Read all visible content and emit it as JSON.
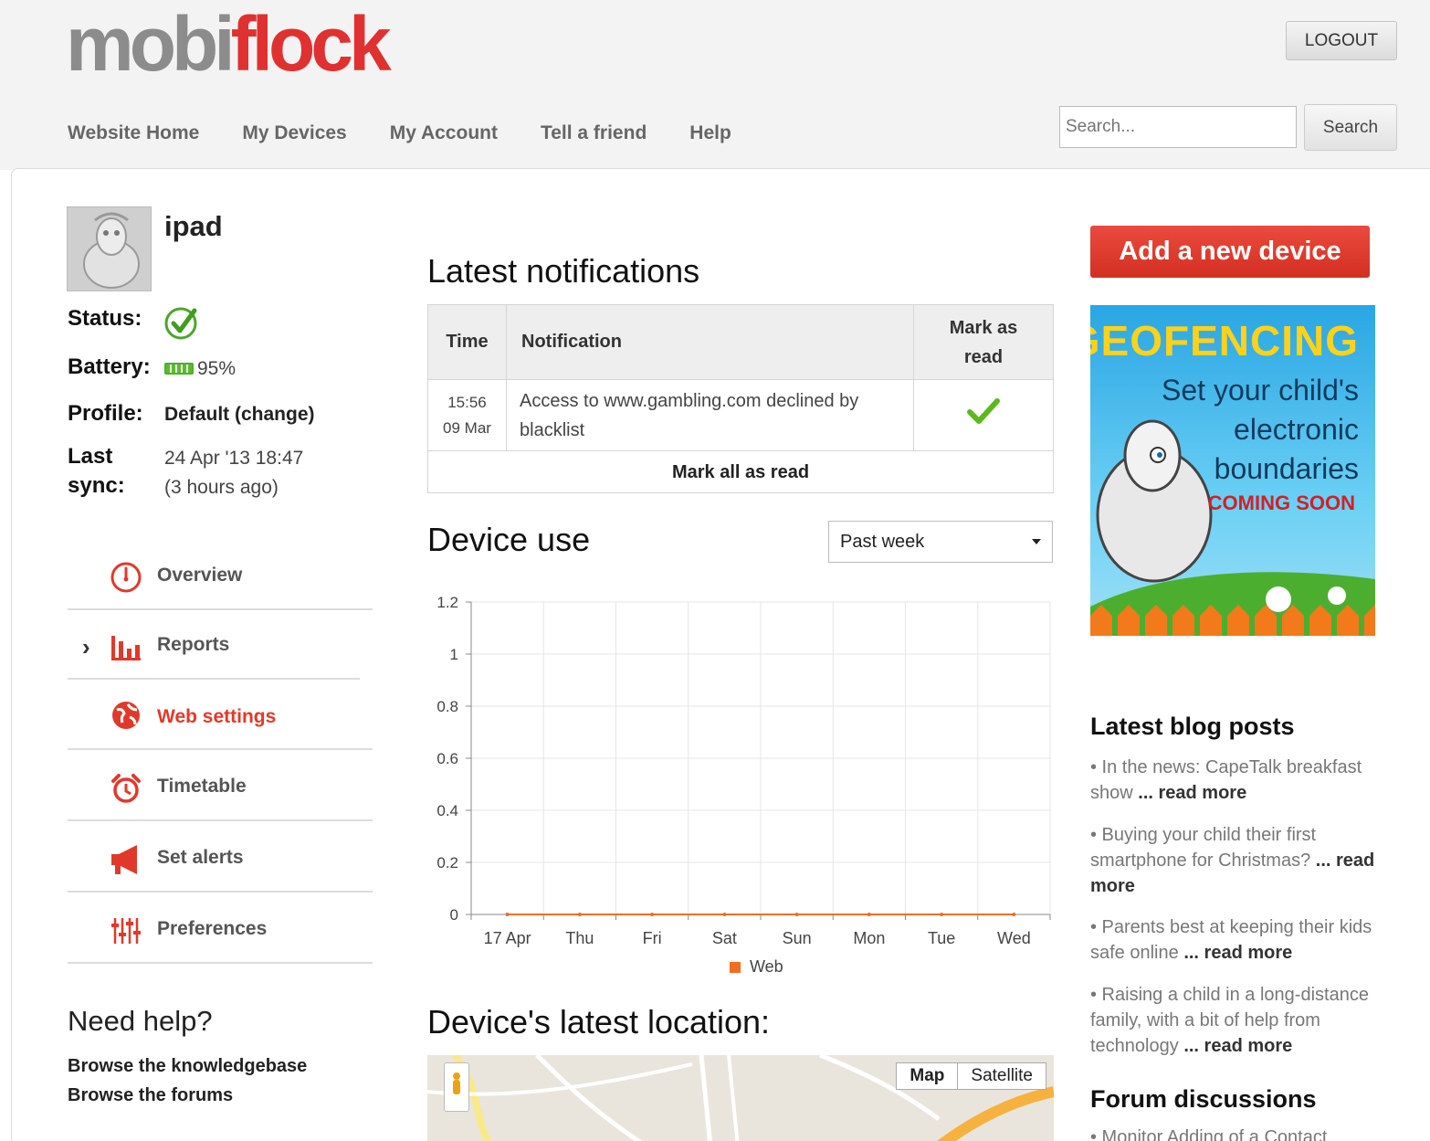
{
  "header": {
    "logo_part1": "mobi",
    "logo_part2": "flock",
    "logout_label": "LOGOUT",
    "nav": [
      "Website Home",
      "My Devices",
      "My Account",
      "Tell a friend",
      "Help"
    ],
    "search_placeholder": "Search...",
    "search_button": "Search"
  },
  "device": {
    "name": "ipad",
    "status_label": "Status:",
    "battery_label": "Battery:",
    "battery_value": "95%",
    "profile_label": "Profile:",
    "profile_value": "Default (change)",
    "last_sync_label_1": "Last",
    "last_sync_label_2": "sync:",
    "last_sync_value": "24 Apr '13 18:47",
    "last_sync_ago": "(3 hours ago)"
  },
  "menu": [
    {
      "label": "Overview",
      "icon": "dashboard-icon"
    },
    {
      "label": "Reports",
      "icon": "bar-chart-icon"
    },
    {
      "label": "Web settings",
      "icon": "globe-icon",
      "active": true
    },
    {
      "label": "Timetable",
      "icon": "alarm-clock-icon"
    },
    {
      "label": "Set alerts",
      "icon": "megaphone-icon"
    },
    {
      "label": "Preferences",
      "icon": "sliders-icon"
    }
  ],
  "help": {
    "title": "Need help?",
    "link1": "Browse the knowledgebase",
    "link2": "Browse the forums"
  },
  "notifications": {
    "title": "Latest notifications",
    "col_time": "Time",
    "col_notification": "Notification",
    "col_mark_1": "Mark as",
    "col_mark_2": "read",
    "rows": [
      {
        "time": "15:56",
        "date": "09 Mar",
        "text_1": "Access to www.gambling.com declined by",
        "text_2": "blacklist"
      }
    ],
    "mark_all": "Mark all as read"
  },
  "device_use": {
    "title": "Device use",
    "range_selected": "Past week"
  },
  "chart_data": {
    "type": "line",
    "categories": [
      "17 Apr",
      "Thu",
      "Fri",
      "Sat",
      "Sun",
      "Mon",
      "Tue",
      "Wed"
    ],
    "series": [
      {
        "name": "Web",
        "values": [
          0,
          0,
          0,
          0,
          0,
          0,
          0,
          0
        ]
      }
    ],
    "ylim": [
      0,
      1.2
    ],
    "yticks": [
      "0",
      "0.2",
      "0.4",
      "0.6",
      "0.8",
      "1",
      "1.2"
    ],
    "grid": true,
    "legend": "bottom",
    "series_color": "#f26d21"
  },
  "location": {
    "title": "Device's latest location:",
    "map_btn": "Map",
    "satellite_btn": "Satellite"
  },
  "sidebar": {
    "add_device": "Add a new device",
    "ad_title": "GEOFENCING",
    "ad_line1": "Set your child's",
    "ad_line2": "electronic",
    "ad_line3": "boundaries",
    "ad_soon": "COMING SOON",
    "blog_title": "Latest blog posts",
    "blog": [
      {
        "text": "• In the news: CapeTalk breakfast show",
        "more": "... read more"
      },
      {
        "text": "• Buying your child their first smartphone for Christmas?",
        "more": "... read more"
      },
      {
        "text": "• Parents best at keeping their kids safe online",
        "more": "... read more"
      },
      {
        "text": "• Raising a child in a long-distance family, with a bit of help from technology",
        "more": "... read more"
      }
    ],
    "forum_title": "Forum discussions",
    "forum_item": "• Monitor Adding of a Contact"
  }
}
